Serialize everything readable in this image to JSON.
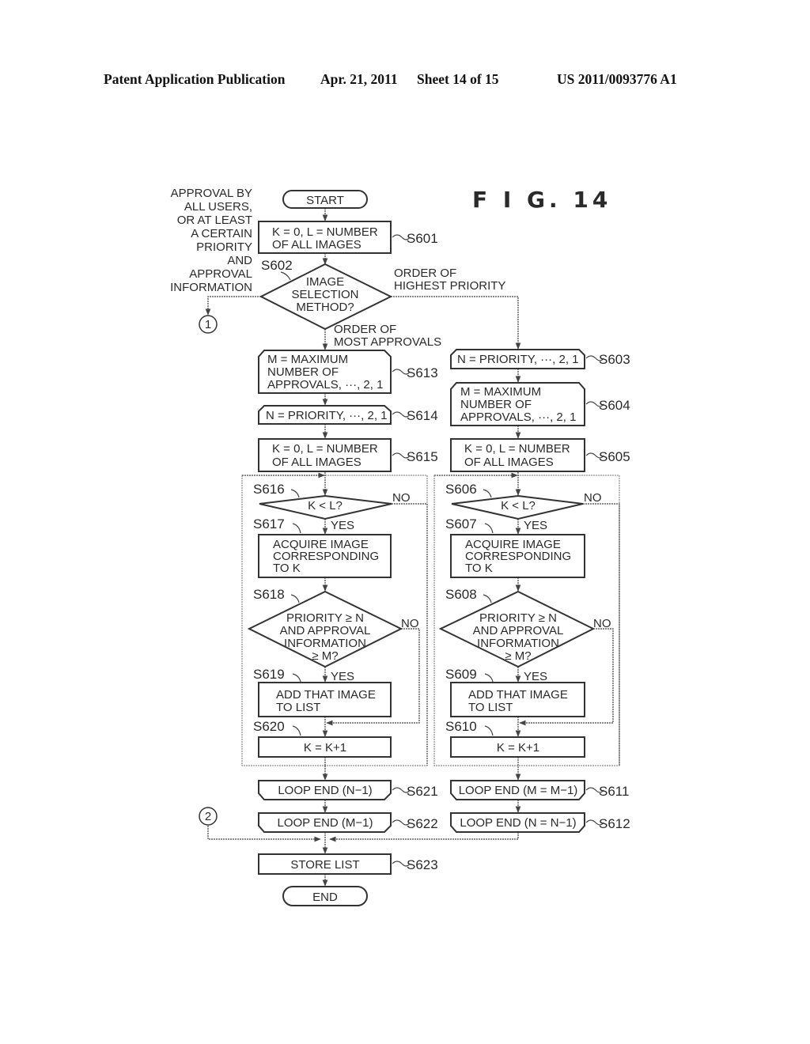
{
  "header": {
    "publication": "Patent Application Publication",
    "date": "Apr. 21, 2011",
    "sheet": "Sheet 14 of 15",
    "number": "US 2011/0093776 A1"
  },
  "figure_label": "F I G. 14",
  "side_note": [
    "APPROVAL BY",
    "ALL USERS,",
    "OR AT LEAST",
    "A CERTAIN",
    "PRIORITY",
    "AND",
    "APPROVAL",
    "INFORMATION"
  ],
  "connectors": {
    "c1": "1",
    "c2": "2"
  },
  "nodes": {
    "start": {
      "text": [
        "START"
      ]
    },
    "s601": {
      "id": "S601",
      "text": [
        "K = 0, L = NUMBER",
        "OF ALL IMAGES"
      ]
    },
    "s602": {
      "id": "S602",
      "text": [
        "IMAGE",
        "SELECTION",
        "METHOD?"
      ]
    },
    "s613": {
      "id": "S613",
      "text": [
        "M = MAXIMUM",
        "NUMBER OF",
        "APPROVALS, ···, 2, 1"
      ]
    },
    "s614": {
      "id": "S614",
      "text": [
        "N = PRIORITY, ···, 2, 1"
      ]
    },
    "s615": {
      "id": "S615",
      "text": [
        "K = 0, L = NUMBER",
        "OF ALL IMAGES"
      ]
    },
    "s616": {
      "id": "S616",
      "text": [
        "K < L?"
      ]
    },
    "s617": {
      "id": "S617",
      "text": [
        "ACQUIRE IMAGE",
        "CORRESPONDING",
        "TO K"
      ]
    },
    "s618": {
      "id": "S618",
      "text": [
        "PRIORITY ≥ N",
        "AND APPROVAL",
        "INFORMATION",
        "≥ M?"
      ]
    },
    "s619": {
      "id": "S619",
      "text": [
        "ADD THAT IMAGE",
        "TO LIST"
      ]
    },
    "s620": {
      "id": "S620",
      "text": [
        "K = K+1"
      ]
    },
    "s621": {
      "id": "S621",
      "text": [
        "LOOP END (N−1)"
      ]
    },
    "s622": {
      "id": "S622",
      "text": [
        "LOOP END (M−1)"
      ]
    },
    "s603": {
      "id": "S603",
      "text": [
        "N = PRIORITY, ···, 2, 1"
      ]
    },
    "s604": {
      "id": "S604",
      "text": [
        "M = MAXIMUM",
        "NUMBER OF",
        "APPROVALS, ···, 2, 1"
      ]
    },
    "s605": {
      "id": "S605",
      "text": [
        "K = 0, L = NUMBER",
        "OF ALL IMAGES"
      ]
    },
    "s606": {
      "id": "S606",
      "text": [
        "K < L?"
      ]
    },
    "s607": {
      "id": "S607",
      "text": [
        "ACQUIRE IMAGE",
        "CORRESPONDING",
        "TO K"
      ]
    },
    "s608": {
      "id": "S608",
      "text": [
        "PRIORITY ≥ N",
        "AND APPROVAL",
        "INFORMATION",
        "≥ M?"
      ]
    },
    "s609": {
      "id": "S609",
      "text": [
        "ADD THAT IMAGE",
        "TO LIST"
      ]
    },
    "s610": {
      "id": "S610",
      "text": [
        "K = K+1"
      ]
    },
    "s611": {
      "id": "S611",
      "text": [
        "LOOP END (M = M−1)"
      ]
    },
    "s612": {
      "id": "S612",
      "text": [
        "LOOP END (N = N−1)"
      ]
    },
    "s623": {
      "id": "S623",
      "text": [
        "STORE LIST"
      ]
    },
    "end": {
      "text": [
        "END"
      ]
    }
  },
  "branch_labels": {
    "highest_priority": [
      "ORDER OF",
      "HIGHEST PRIORITY"
    ],
    "most_approvals": [
      "ORDER OF",
      "MOST APPROVALS"
    ],
    "yes": "YES",
    "no": "NO"
  }
}
